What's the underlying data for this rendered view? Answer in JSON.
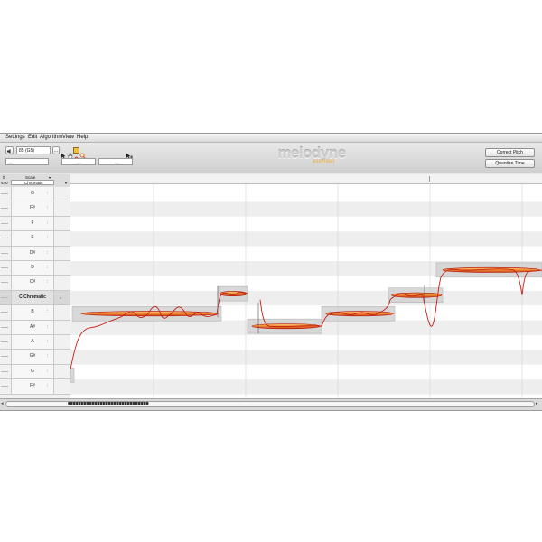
{
  "menu": [
    "Settings",
    "Edit",
    "Algorithm",
    "View",
    "Help"
  ],
  "toolbar": {
    "tempo_value": "85 (G5)",
    "tempo_more": "...",
    "left_field_a": "...",
    "left_field_b": "...",
    "tool_field_a": "...",
    "tool_field_b": "...",
    "logo_main": "melodyne",
    "logo_sub": "essential",
    "correct_pitch_label": "Correct Pitch",
    "quantize_time_label": "Quantize Time"
  },
  "keyhead": {
    "scale_label": "Scale",
    "tuning_value": "440",
    "scale_value": "Chromatic"
  },
  "keyboard": {
    "notes": [
      "G",
      "F#",
      "F",
      "E",
      "D#",
      "D",
      "C#",
      "C Chromatic",
      "B",
      "A#",
      "A",
      "G#",
      "G",
      "F#"
    ],
    "scale_marker": "4"
  },
  "colors": {
    "blob_fill": "#ef8a2e",
    "blob_stroke": "#b81c12",
    "pitch_curve": "#c71d14",
    "note_box": "#d2d2d2",
    "selected_row": "#d7d7d7"
  },
  "icons": [
    "pointer-icon",
    "hand-icon",
    "pitch-tool-icon",
    "zoom-icon",
    "cursor-icon",
    "speaker-icon"
  ]
}
